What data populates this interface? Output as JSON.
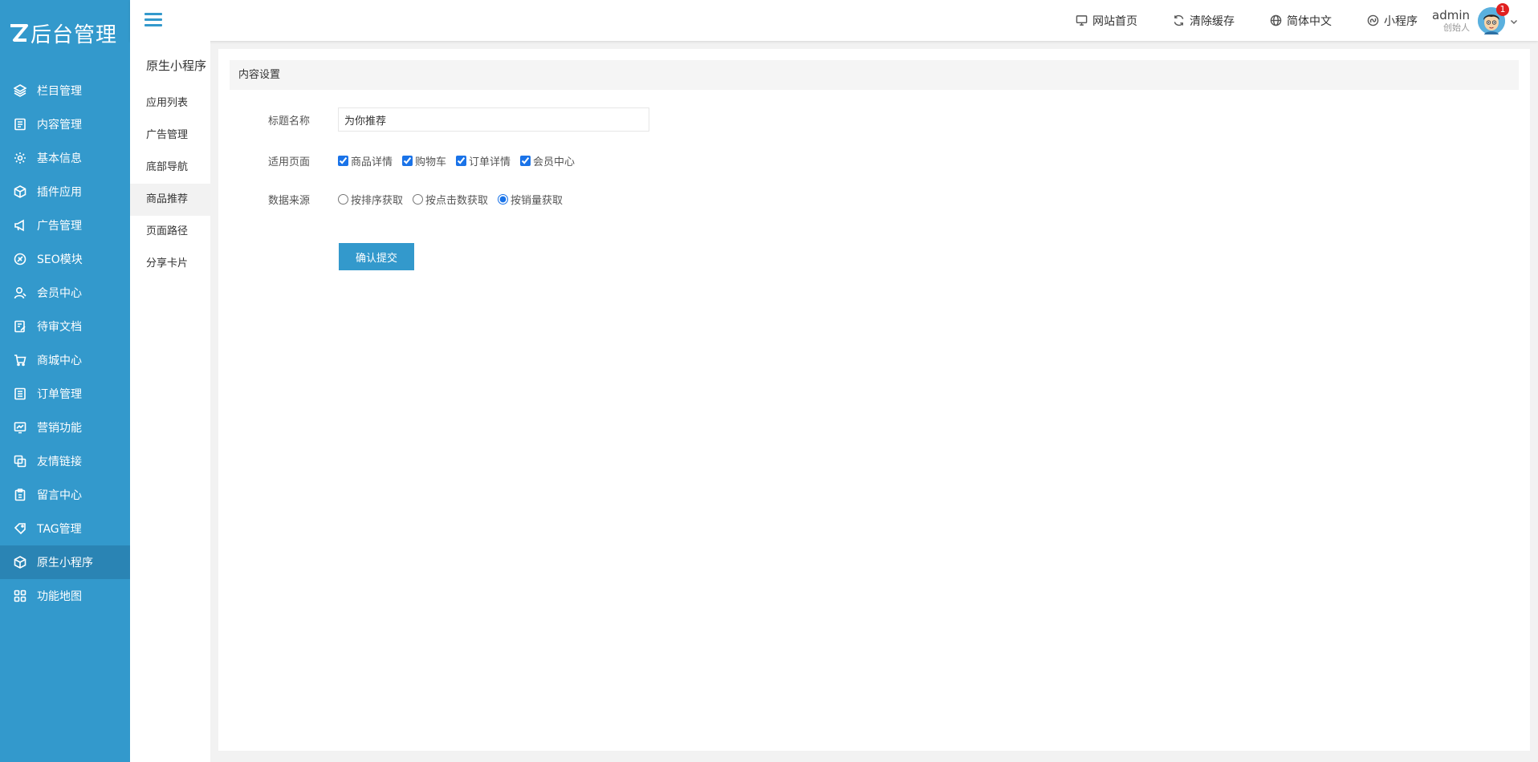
{
  "app": {
    "logo_text": "后台管理"
  },
  "sidebar": {
    "items": [
      {
        "label": "栏目管理",
        "icon": "layers-icon"
      },
      {
        "label": "内容管理",
        "icon": "document-icon"
      },
      {
        "label": "基本信息",
        "icon": "gear-icon"
      },
      {
        "label": "插件应用",
        "icon": "cube-icon"
      },
      {
        "label": "广告管理",
        "icon": "megaphone-icon"
      },
      {
        "label": "SEO模块",
        "icon": "seo-icon"
      },
      {
        "label": "会员中心",
        "icon": "user-icon"
      },
      {
        "label": "待审文档",
        "icon": "edit-doc-icon"
      },
      {
        "label": "商城中心",
        "icon": "cart-icon"
      },
      {
        "label": "订单管理",
        "icon": "list-icon"
      },
      {
        "label": "营销功能",
        "icon": "chart-icon"
      },
      {
        "label": "友情链接",
        "icon": "link-icon"
      },
      {
        "label": "留言中心",
        "icon": "clipboard-icon"
      },
      {
        "label": "TAG管理",
        "icon": "tag-icon"
      },
      {
        "label": "原生小程序",
        "icon": "cube-icon",
        "active": true
      },
      {
        "label": "功能地图",
        "icon": "grid-icon"
      }
    ]
  },
  "header": {
    "links": [
      {
        "label": "网站首页",
        "icon": "monitor-icon"
      },
      {
        "label": "清除缓存",
        "icon": "refresh-icon"
      },
      {
        "label": "简体中文",
        "icon": "globe-icon"
      },
      {
        "label": "小程序",
        "icon": "miniprogram-icon"
      }
    ],
    "user": {
      "name": "admin",
      "role": "创始人",
      "notifications": "1"
    }
  },
  "subnav": {
    "title": "原生小程序",
    "items": [
      {
        "label": "应用列表"
      },
      {
        "label": "广告管理"
      },
      {
        "label": "底部导航"
      },
      {
        "label": "商品推荐",
        "active": true
      },
      {
        "label": "页面路径"
      },
      {
        "label": "分享卡片"
      }
    ]
  },
  "main": {
    "section_title": "内容设置",
    "form": {
      "title_label": "标题名称",
      "title_value": "为你推荐",
      "pages_label": "适用页面",
      "pages_options": [
        {
          "label": "商品详情",
          "checked": true
        },
        {
          "label": "购物车",
          "checked": true
        },
        {
          "label": "订单详情",
          "checked": true
        },
        {
          "label": "会员中心",
          "checked": true
        }
      ],
      "source_label": "数据来源",
      "source_options": [
        {
          "label": "按排序获取",
          "checked": false
        },
        {
          "label": "按点击数获取",
          "checked": false
        },
        {
          "label": "按销量获取",
          "checked": true
        }
      ],
      "submit_label": "确认提交"
    }
  },
  "colors": {
    "primary": "#3399cc",
    "sidebar_active": "#2a84b4",
    "badge": "#e02020"
  }
}
